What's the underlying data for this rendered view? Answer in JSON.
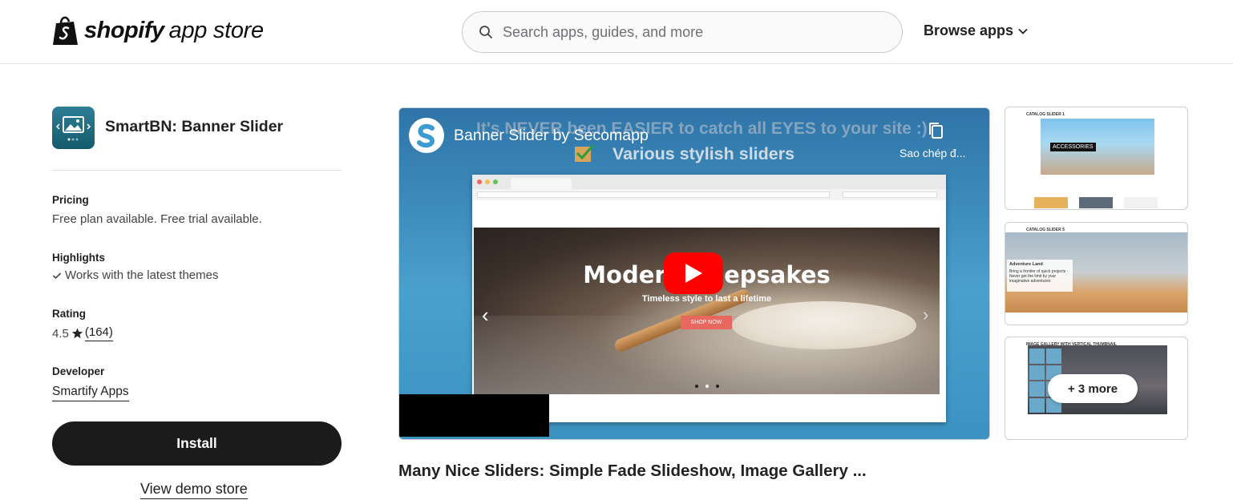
{
  "header": {
    "logo_word": "shopify",
    "logo_suffix": "app store",
    "search_placeholder": "Search apps, guides, and more",
    "browse_label": "Browse apps"
  },
  "app": {
    "name": "SmartBN: Banner Slider",
    "pricing_label": "Pricing",
    "pricing_value": "Free plan available. Free trial available.",
    "highlights_label": "Highlights",
    "highlights_value": "Works with the latest themes",
    "rating_label": "Rating",
    "rating_value": "4.5",
    "rating_count": "(164)",
    "developer_label": "Developer",
    "developer_name": "Smartify Apps",
    "install_label": "Install",
    "demo_label": "View demo store"
  },
  "video": {
    "title": "Banner Slider by Secomapp",
    "banner_text": "It's NEVER been EASIER to catch all EYES to your site :)",
    "subtitle": "Various stylish sliders",
    "copy_label": "Sao chép đ...",
    "hero_title": "Modern Keepsakes",
    "hero_sub": "Timeless style to last a lifetime",
    "hero_button": "SHOP NOW"
  },
  "caption": "Many Nice Sliders: Simple Fade Slideshow, Image Gallery ...",
  "thumbnails": {
    "t1_head": "CATALOG SLIDER 1",
    "t1_tag": "ACCESSORIES",
    "t2_head": "CATALOG SLIDER 5",
    "t2_title": "Adventure Land",
    "t2_text": "Bring a frontier of quick projects - Never get the limit by your imaginative adventures",
    "t3_head": "IMAGE GALLERY WITH VERTICAL THUMBNAIL",
    "more_label": "+ 3 more"
  }
}
